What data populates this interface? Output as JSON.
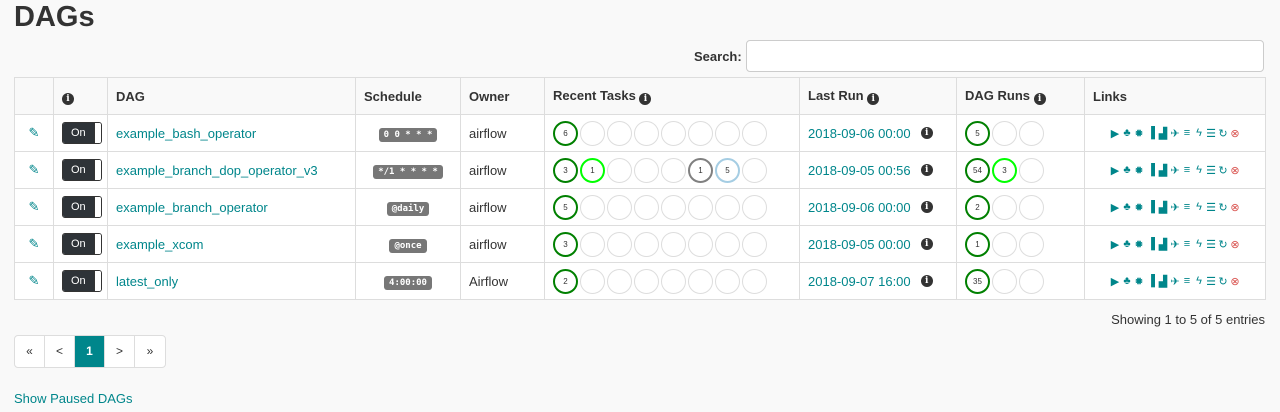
{
  "page": {
    "title": "DAGs"
  },
  "search": {
    "label": "Search:",
    "value": ""
  },
  "table": {
    "headers": {
      "info": "i",
      "dag": "DAG",
      "schedule": "Schedule",
      "owner": "Owner",
      "recent_tasks": "Recent Tasks",
      "last_run": "Last Run",
      "dag_runs": "DAG Runs",
      "links": "Links"
    },
    "toggle_label": "On",
    "rows": [
      {
        "dag": "example_bash_operator",
        "schedule": "0 0 * * *",
        "owner": "airflow",
        "last_run": "2018-09-06 00:00",
        "recent_tasks": [
          {
            "state": "success",
            "count": "6"
          },
          {
            "state": "empty",
            "count": ""
          },
          {
            "state": "empty",
            "count": ""
          },
          {
            "state": "empty",
            "count": ""
          },
          {
            "state": "empty",
            "count": ""
          },
          {
            "state": "empty",
            "count": ""
          },
          {
            "state": "empty",
            "count": ""
          },
          {
            "state": "empty",
            "count": ""
          }
        ],
        "dag_runs": [
          {
            "state": "success",
            "count": "5"
          },
          {
            "state": "empty",
            "count": ""
          },
          {
            "state": "empty",
            "count": ""
          }
        ]
      },
      {
        "dag": "example_branch_dop_operator_v3",
        "schedule": "*/1 * * * *",
        "owner": "airflow",
        "last_run": "2018-09-05 00:56",
        "recent_tasks": [
          {
            "state": "success",
            "count": "3"
          },
          {
            "state": "running",
            "count": "1"
          },
          {
            "state": "empty",
            "count": ""
          },
          {
            "state": "empty",
            "count": ""
          },
          {
            "state": "empty",
            "count": ""
          },
          {
            "state": "upstream",
            "count": "1"
          },
          {
            "state": "skipped",
            "count": "5"
          },
          {
            "state": "empty",
            "count": ""
          }
        ],
        "dag_runs": [
          {
            "state": "success",
            "count": "54"
          },
          {
            "state": "running",
            "count": "3"
          },
          {
            "state": "empty",
            "count": ""
          }
        ]
      },
      {
        "dag": "example_branch_operator",
        "schedule": "@daily",
        "owner": "airflow",
        "last_run": "2018-09-06 00:00",
        "recent_tasks": [
          {
            "state": "success",
            "count": "5"
          },
          {
            "state": "empty",
            "count": ""
          },
          {
            "state": "empty",
            "count": ""
          },
          {
            "state": "empty",
            "count": ""
          },
          {
            "state": "empty",
            "count": ""
          },
          {
            "state": "empty",
            "count": ""
          },
          {
            "state": "empty",
            "count": ""
          },
          {
            "state": "empty",
            "count": ""
          }
        ],
        "dag_runs": [
          {
            "state": "success",
            "count": "2"
          },
          {
            "state": "empty",
            "count": ""
          },
          {
            "state": "empty",
            "count": ""
          }
        ]
      },
      {
        "dag": "example_xcom",
        "schedule": "@once",
        "owner": "airflow",
        "last_run": "2018-09-05 00:00",
        "recent_tasks": [
          {
            "state": "success",
            "count": "3"
          },
          {
            "state": "empty",
            "count": ""
          },
          {
            "state": "empty",
            "count": ""
          },
          {
            "state": "empty",
            "count": ""
          },
          {
            "state": "empty",
            "count": ""
          },
          {
            "state": "empty",
            "count": ""
          },
          {
            "state": "empty",
            "count": ""
          },
          {
            "state": "empty",
            "count": ""
          }
        ],
        "dag_runs": [
          {
            "state": "success",
            "count": "1"
          },
          {
            "state": "empty",
            "count": ""
          },
          {
            "state": "empty",
            "count": ""
          }
        ]
      },
      {
        "dag": "latest_only",
        "schedule": "4:00:00",
        "owner": "Airflow",
        "last_run": "2018-09-07 16:00",
        "recent_tasks": [
          {
            "state": "success",
            "count": "2"
          },
          {
            "state": "empty",
            "count": ""
          },
          {
            "state": "empty",
            "count": ""
          },
          {
            "state": "empty",
            "count": ""
          },
          {
            "state": "empty",
            "count": ""
          },
          {
            "state": "empty",
            "count": ""
          },
          {
            "state": "empty",
            "count": ""
          },
          {
            "state": "empty",
            "count": ""
          }
        ],
        "dag_runs": [
          {
            "state": "success",
            "count": "35"
          },
          {
            "state": "empty",
            "count": ""
          },
          {
            "state": "empty",
            "count": ""
          }
        ]
      }
    ],
    "link_icons": [
      {
        "name": "trigger-dag-icon",
        "glyph": "▶"
      },
      {
        "name": "tree-view-icon",
        "glyph": "♣"
      },
      {
        "name": "graph-view-icon",
        "glyph": "✹"
      },
      {
        "name": "task-duration-icon",
        "glyph": "▐"
      },
      {
        "name": "task-tries-icon",
        "glyph": "▟"
      },
      {
        "name": "landing-times-icon",
        "glyph": "✈"
      },
      {
        "name": "gantt-icon",
        "glyph": "≡"
      },
      {
        "name": "code-view-icon",
        "glyph": "ϟ"
      },
      {
        "name": "logs-icon",
        "glyph": "☰"
      },
      {
        "name": "refresh-icon",
        "glyph": "↻"
      },
      {
        "name": "delete-icon",
        "glyph": "⊗"
      }
    ]
  },
  "footer": {
    "showing": "Showing 1 to 5 of 5 entries",
    "pager": [
      "«",
      "<",
      "1",
      ">",
      "»"
    ],
    "pager_active": "1",
    "show_paused": "Show Paused DAGs"
  },
  "colors": {
    "accent": "#00868b",
    "success": "#008000",
    "running": "#00ff00",
    "upstream_failed": "#808080",
    "skipped": "#a5cde3",
    "delete": "#d9534f"
  }
}
